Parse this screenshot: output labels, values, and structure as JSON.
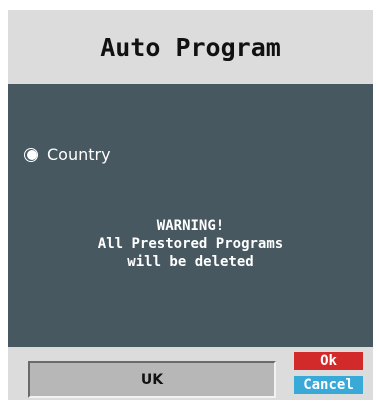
{
  "dialog": {
    "title": "Auto Program",
    "option": {
      "label": "Country",
      "selected": true
    },
    "warning": {
      "line1": "WARNING!",
      "line2": "All Prestored Programs",
      "line3": "will be deleted"
    },
    "country_value": "UK",
    "buttons": {
      "ok": "Ok",
      "cancel": "Cancel"
    }
  },
  "colors": {
    "title_bg": "#dcdcdc",
    "panel_bg": "#475860",
    "ok_button": "#d22a2a",
    "cancel_button": "#39a9d8"
  },
  "icons": {
    "option_radio": "radio-selected-icon"
  }
}
